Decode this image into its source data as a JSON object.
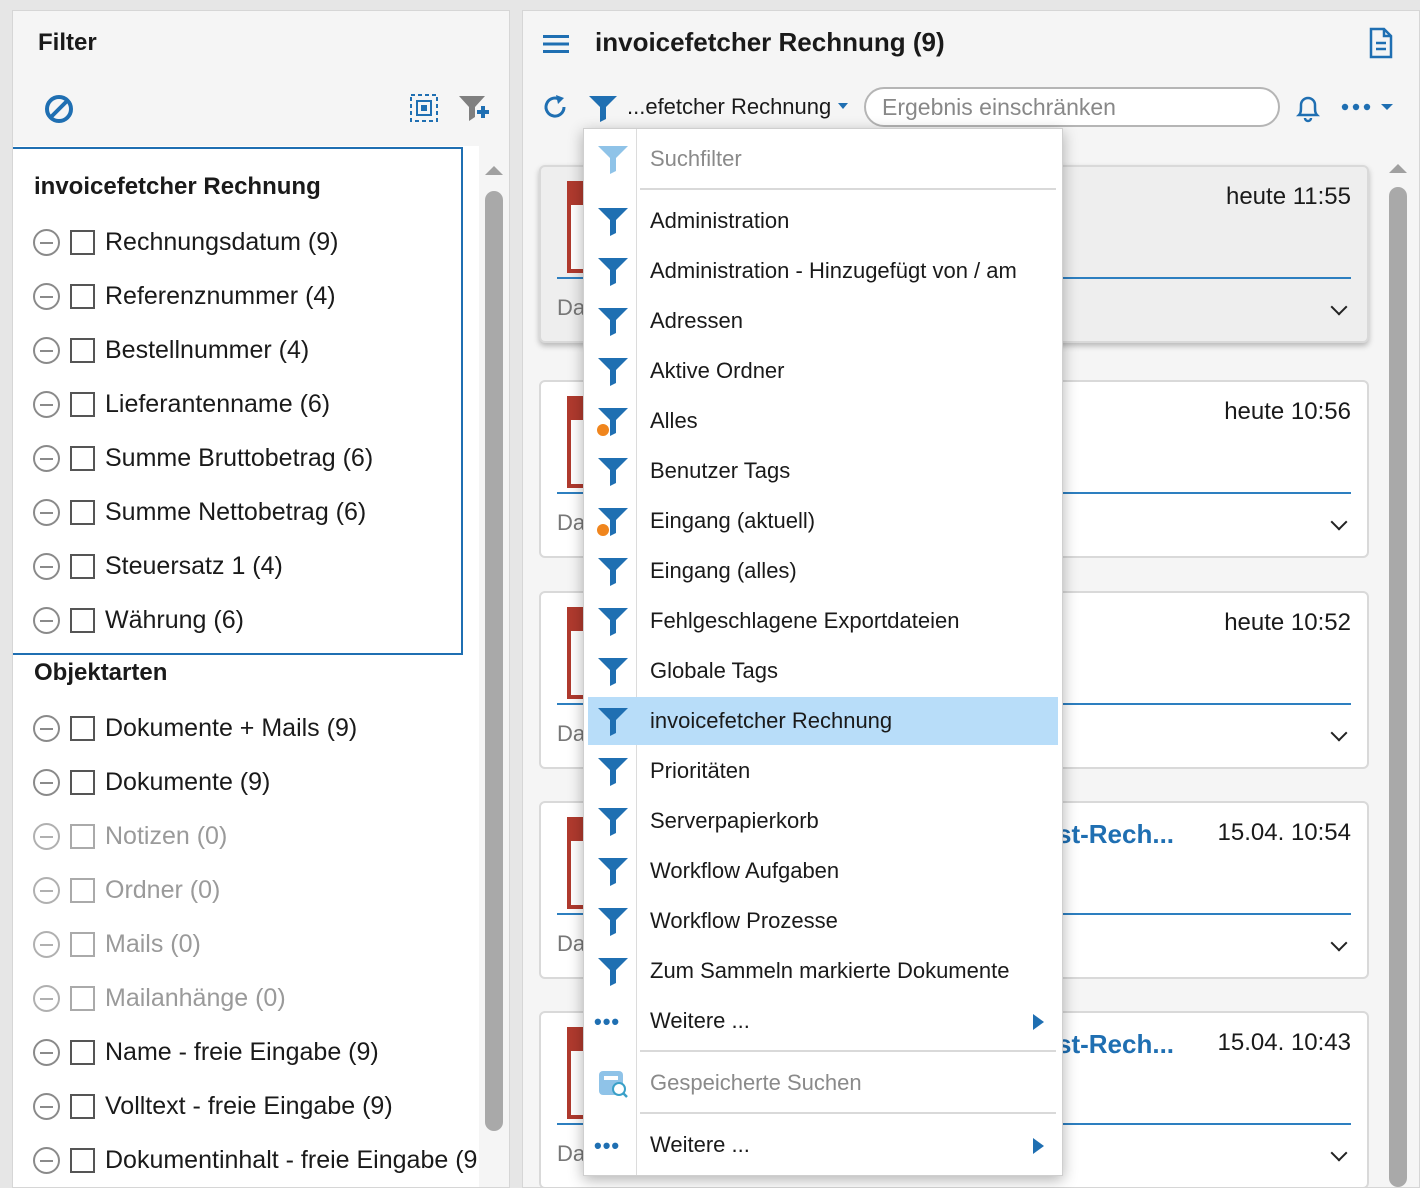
{
  "left_panel": {
    "title": "Filter",
    "groups": [
      {
        "title": "invoicefetcher Rechnung",
        "items": [
          {
            "label": "Rechnungsdatum (9)",
            "enabled": true
          },
          {
            "label": "Referenznummer (4)",
            "enabled": true
          },
          {
            "label": "Bestellnummer (4)",
            "enabled": true
          },
          {
            "label": "Lieferantenname (6)",
            "enabled": true
          },
          {
            "label": "Summe Bruttobetrag (6)",
            "enabled": true
          },
          {
            "label": "Summe Nettobetrag (6)",
            "enabled": true
          },
          {
            "label": "Steuersatz 1 (4)",
            "enabled": true
          },
          {
            "label": "Währung (6)",
            "enabled": true
          }
        ]
      },
      {
        "title": "Objektarten",
        "items": [
          {
            "label": "Dokumente + Mails (9)",
            "enabled": true
          },
          {
            "label": "Dokumente (9)",
            "enabled": true
          },
          {
            "label": "Notizen (0)",
            "enabled": false
          },
          {
            "label": "Ordner (0)",
            "enabled": false
          },
          {
            "label": "Mails (0)",
            "enabled": false
          },
          {
            "label": "Mailanhänge (0)",
            "enabled": false
          },
          {
            "label": "Name - freie Eingabe (9)",
            "enabled": true
          },
          {
            "label": "Volltext - freie Eingabe (9)",
            "enabled": true
          },
          {
            "label": "Dokumentinhalt - freie Eingabe (9",
            "enabled": true
          }
        ]
      }
    ]
  },
  "right_panel": {
    "title": "invoicefetcher Rechnung (9)",
    "selected_filter": "...efetcher Rechnung",
    "search_placeholder": "Ergebnis einschränken",
    "cards": [
      {
        "time": "heute 11:55",
        "title": "",
        "label": "Da",
        "active": true
      },
      {
        "time": "heute 10:56",
        "title": "",
        "label": "Da",
        "active": false
      },
      {
        "time": "heute 10:52",
        "title": "",
        "label": "Da",
        "active": false
      },
      {
        "time": "15.04. 10:54",
        "title": "st-Rech...",
        "label": "Da",
        "active": false
      },
      {
        "time": "15.04. 10:43",
        "title": "st-Rech...",
        "label": "Da",
        "active": false
      }
    ]
  },
  "menu": {
    "header": "Suchfilter",
    "items": [
      {
        "label": "Administration",
        "badge": false
      },
      {
        "label": "Administration - Hinzugefügt von / am",
        "badge": false
      },
      {
        "label": "Adressen",
        "badge": false
      },
      {
        "label": "Aktive Ordner",
        "badge": false
      },
      {
        "label": "Alles",
        "badge": true
      },
      {
        "label": "Benutzer Tags",
        "badge": false
      },
      {
        "label": "Eingang (aktuell)",
        "badge": true
      },
      {
        "label": "Eingang (alles)",
        "badge": false
      },
      {
        "label": "Fehlgeschlagene Exportdateien",
        "badge": false
      },
      {
        "label": "Globale Tags",
        "badge": false
      },
      {
        "label": "invoicefetcher Rechnung",
        "badge": false,
        "selected": true
      },
      {
        "label": "Prioritäten",
        "badge": false
      },
      {
        "label": "Serverpapierkorb",
        "badge": false
      },
      {
        "label": "Workflow Aufgaben",
        "badge": false
      },
      {
        "label": "Workflow Prozesse",
        "badge": false
      },
      {
        "label": "Zum Sammeln markierte Dokumente",
        "badge": false
      }
    ],
    "more_label": "Weitere ...",
    "saved_header": "Gespeicherte Suchen",
    "saved_more_label": "Weitere ..."
  },
  "colors": {
    "accent": "#1f6fb2",
    "selection": "#b8ddf9",
    "badge": "#f0851d",
    "pdf": "#b03a2e"
  }
}
